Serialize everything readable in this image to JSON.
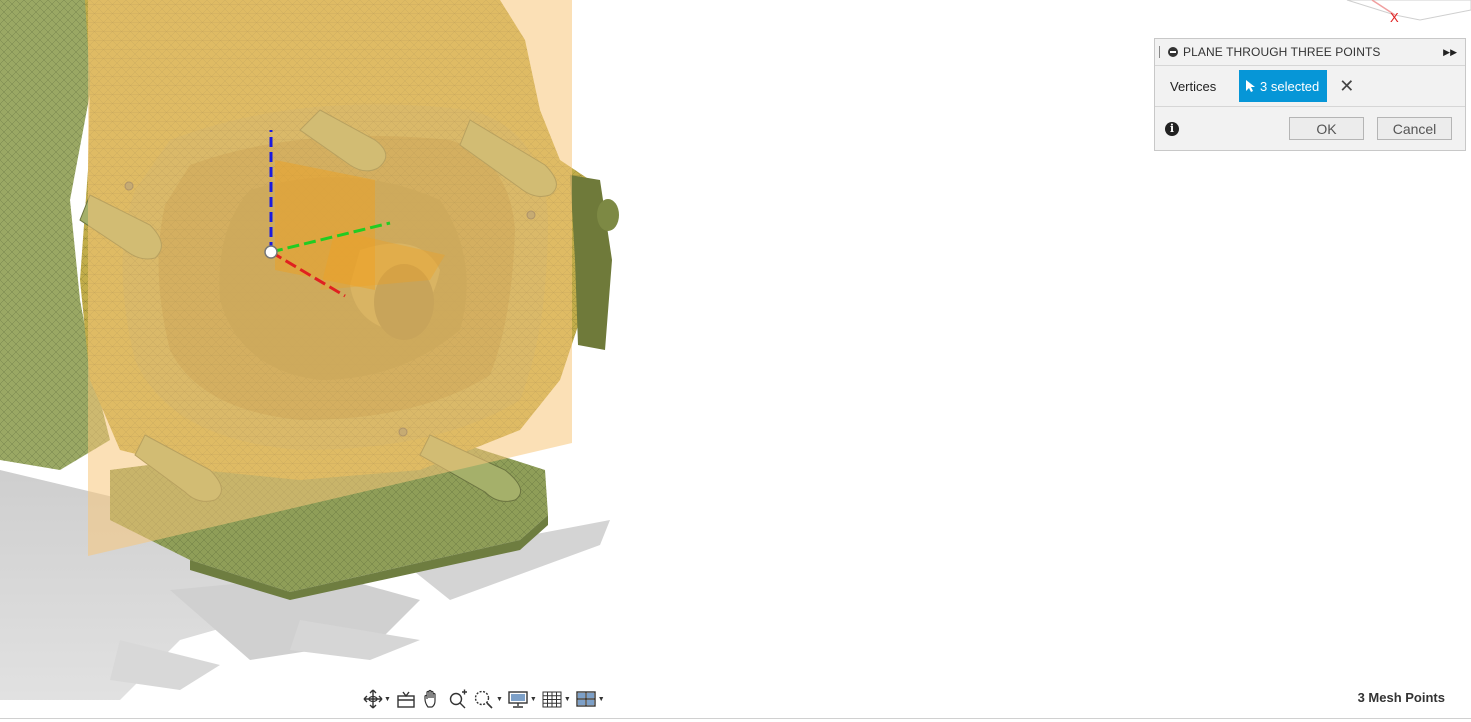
{
  "dialog": {
    "title": "PLANE THROUGH THREE POINTS",
    "vertices_label": "Vertices",
    "selection_text": "3 selected",
    "ok_label": "OK",
    "cancel_label": "Cancel"
  },
  "viewcube": {
    "axis_label": "X"
  },
  "status": {
    "text": "3 Mesh Points"
  },
  "navbar": {
    "tools": [
      "orbit-icon",
      "look-at-icon",
      "pan-icon",
      "zoom-icon",
      "zoom-window-icon",
      "display-settings-icon",
      "grid-icon",
      "viewports-icon"
    ]
  },
  "colors": {
    "mesh": "#c9b04a",
    "plane": "#f8c77a",
    "selection_accent": "#0696d7",
    "axis_x": "#e02020",
    "axis_y": "#22cc22",
    "axis_z": "#1a1ae0"
  }
}
